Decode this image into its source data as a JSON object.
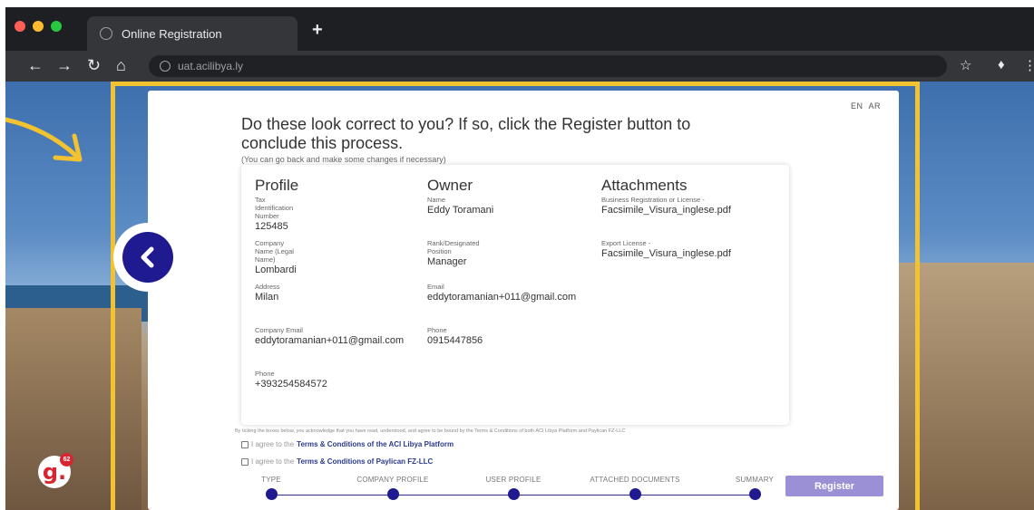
{
  "browser": {
    "tab_title": "Online Registration",
    "new_tab_symbol": "+",
    "url": "uat.acilibya.ly",
    "icons": [
      "back-arrow-icon",
      "forward-arrow-icon",
      "reload-icon",
      "home-icon",
      "globe-icon",
      "star-icon",
      "puzzle-icon",
      "more-icon"
    ]
  },
  "page": {
    "lang_en": "EN",
    "lang_ar": "AR",
    "heading": "Do these look correct to you? If so, click the Register button to conclude this process.",
    "subheading": "(You can go back and make some changes if necessary)"
  },
  "profile": {
    "title": "Profile",
    "tin_label": "Tax Identification Number",
    "tin_value": "125485",
    "company_name_label": "Company Name (Legal Name)",
    "company_name_value": "Lombardi",
    "address_label": "Address",
    "address_value": "Milan",
    "company_email_label": "Company Email",
    "company_email_value": "eddytoramanian+011@gmail.com",
    "phone_label": "Phone",
    "phone_value": "+393254584572"
  },
  "owner": {
    "title": "Owner",
    "name_label": "Name",
    "name_value": "Eddy Toramani",
    "rank_label": "Rank/Designated Position",
    "rank_value": "Manager",
    "email_label": "Email",
    "email_value": "eddytoramanian+011@gmail.com",
    "phone_label": "Phone",
    "phone_value": "0915447856"
  },
  "attachments": {
    "title": "Attachments",
    "business_label": "Business Registration or License -",
    "business_value": "Facsimile_Visura_inglese.pdf",
    "export_label": "Export License -",
    "export_value": "Facsimile_Visura_inglese.pdf"
  },
  "consent": {
    "text": "By ticking the boxes below, you acknowledge that you have read, understood, and agree to be bound by the Terms & Conditions of both ACI Libya Platform and Paylican FZ-LLC",
    "check1_prefix": "I agree to the",
    "check1_link": "Terms & Conditions of the ACI Libya Platform",
    "check2_prefix": "I agree to the",
    "check2_link": "Terms & Conditions of Paylican FZ-LLC"
  },
  "stepper": {
    "steps": [
      "TYPE",
      "COMPANY PROFILE",
      "USER PROFILE",
      "ATTACHED DOCUMENTS",
      "SUMMARY"
    ]
  },
  "register_label": "Register",
  "badge_count": "62",
  "logo_letter": "g.",
  "colors": {
    "accent": "#1f1a8f",
    "register_button": "#9b8fd6",
    "frame": "#f2c230",
    "link": "#2a3a8c"
  }
}
